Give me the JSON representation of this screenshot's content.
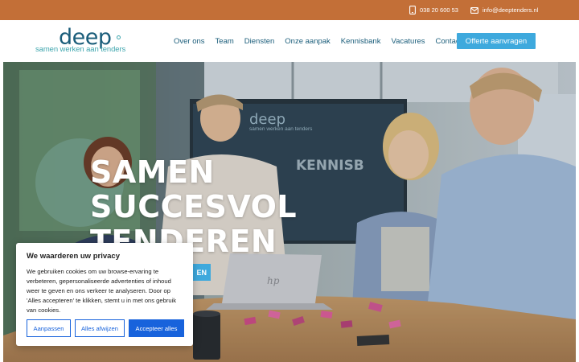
{
  "topbar": {
    "phone": "038 20 600 53",
    "email": "info@deeptenders.nl",
    "background": "#c36f37"
  },
  "logo": {
    "word": "deep",
    "tagline": "samen werken aan tenders"
  },
  "nav": {
    "items": [
      "Over ons",
      "Team",
      "Diensten",
      "Onze aanpak",
      "Kennisbank",
      "Vacatures",
      "Contact"
    ],
    "cta": "Offerte aanvragen"
  },
  "hero": {
    "title_lines": [
      "SAMEN",
      "SUCCESVOL",
      "TENDEREN"
    ],
    "button_label": "EN",
    "wall_sign": "KENNISB",
    "screen_logo": "deep",
    "screen_tagline": "samen werken aan tenders"
  },
  "cookie": {
    "title": "We waarderen uw privacy",
    "body": "We gebruiken cookies om uw browse-ervaring te verbeteren, gepersonaliseerde advertenties of inhoud weer te geven en ons verkeer te analyseren. Door op 'Alles accepteren' te klikken, stemt u in met ons gebruik van cookies.",
    "customize": "Aanpassen",
    "reject": "Alles afwijzen",
    "accept": "Accepteer alles"
  },
  "colors": {
    "brand_dark": "#1a5d7a",
    "brand_teal": "#3fa6ae",
    "accent_blue": "#3ea9dd",
    "cookie_blue": "#1863dc"
  }
}
